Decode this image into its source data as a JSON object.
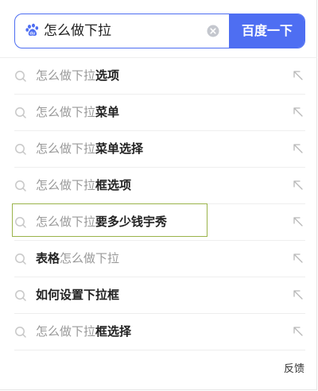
{
  "search": {
    "value": "怎么做下拉",
    "button_label": "百度一下"
  },
  "suggestions": [
    {
      "plain": "怎么做下拉",
      "bold": "选项",
      "order": "prefix"
    },
    {
      "plain": "怎么做下拉",
      "bold": "菜单",
      "order": "prefix"
    },
    {
      "plain": "怎么做下拉",
      "bold": "菜单选择",
      "order": "prefix"
    },
    {
      "plain": "怎么做下拉",
      "bold": "框选项",
      "order": "prefix"
    },
    {
      "plain": "怎么做下拉",
      "bold": "要多少钱宇秀",
      "order": "prefix"
    },
    {
      "plain": "怎么做下拉",
      "bold": "表格",
      "order": "suffix"
    },
    {
      "plain": "",
      "bold": "如何设置下拉框",
      "order": "prefix"
    },
    {
      "plain": "怎么做下拉",
      "bold": "框选择",
      "order": "prefix"
    }
  ],
  "feedback_label": "反馈",
  "colors": {
    "accent": "#4e6ef2",
    "highlight_border": "#9ab34a"
  }
}
